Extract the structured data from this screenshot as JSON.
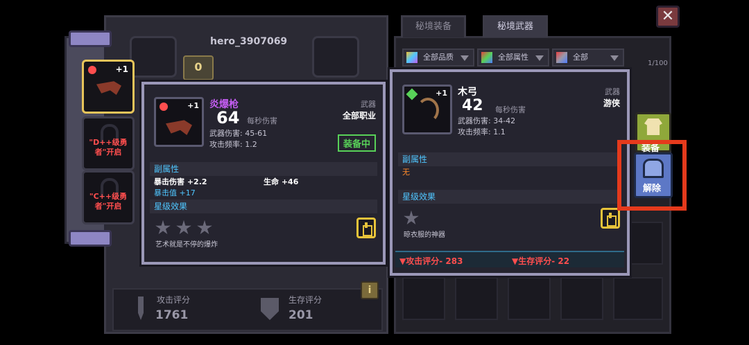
{
  "close_label": "✕",
  "hero": {
    "name": "hero_3907069",
    "level": "0"
  },
  "tabs": [
    {
      "label": "秘境装备"
    },
    {
      "label": "秘境武器"
    }
  ],
  "filters": [
    {
      "label": "全部品质"
    },
    {
      "label": "全部属性"
    },
    {
      "label": "全部"
    }
  ],
  "inventory_count": "1/100",
  "slots": [
    {
      "plus": "+1"
    },
    {
      "lock_text": "\"D++级勇者\"开启"
    },
    {
      "lock_text": "\"C++级勇者\"开启"
    }
  ],
  "equipped": {
    "name": "炎爆枪",
    "plus": "+1",
    "dps": "64",
    "dps_label": "每秒伤害",
    "damage": "武器伤害: 45-61",
    "rate": "攻击频率: 1.2",
    "type": "武器",
    "profession": "全部职业",
    "status": "装备中",
    "sub_title": "副属性",
    "sub1": "暴击伤害 +2.2",
    "sub2": "生命 +46",
    "sub3": "暴击值 +17",
    "star_title": "星级效果",
    "desc": "艺术就是不停的爆炸"
  },
  "compare": {
    "name": "木弓",
    "plus": "+1",
    "dps": "42",
    "dps_label": "每秒伤害",
    "damage": "武器伤害: 34-42",
    "rate": "攻击频率: 1.1",
    "type": "武器",
    "profession": "游侠",
    "sub_title": "副属性",
    "sub_none": "无",
    "star_title": "星级效果",
    "desc": "晾衣服的神器",
    "atk_delta": "▼攻击评分- 283",
    "hp_delta": "▼生存评分- 22"
  },
  "side_buttons": {
    "equip": "装备",
    "unlock": "解除"
  },
  "scores": {
    "atk_label": "攻击评分",
    "atk": "1761",
    "hp_label": "生存评分",
    "hp": "201"
  },
  "info_icon": "i",
  "colors": {
    "purple_name": "#c25cf0",
    "red": "#ff4e4e",
    "blue": "#4fc6ff",
    "green": "#58d158",
    "highlight": "#e53a1c"
  }
}
